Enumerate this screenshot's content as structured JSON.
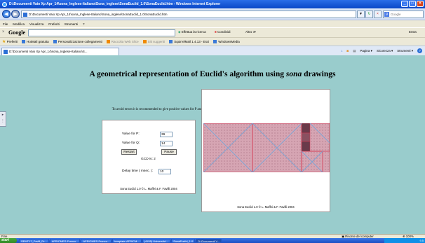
{
  "window": {
    "title": "D:\\Documenti Vaio Xp Apr_14\\sona_Inglese-Italiano\\Sona_inglese\\SonaEuclid_1.0\\SonaEuclid.htm - Windows Internet Explorer",
    "min": "_",
    "max": "□",
    "close": "×"
  },
  "address_bar": {
    "back": "◀",
    "forward": "▶",
    "url": "D:\\Documenti Vaio Xp Apr_14\\sona_Inglese-Italiano\\Sona_inglese\\SonaEuclid_1.0\\SonaEuclid.htm",
    "dropdown": "▼",
    "refresh": "↻",
    "stop": "×",
    "search_placeholder": "Google",
    "search_logo": "g",
    "search_go": "ρ"
  },
  "menu": [
    "File",
    "Modifica",
    "Visualizza",
    "Preferiti",
    "Strumenti",
    "?"
  ],
  "google_toolbar": {
    "close": "×",
    "logo": "Google",
    "search_go": "Effettua la ricerca",
    "share": "Condividi",
    "more": "Altro",
    "more_arrows": "≫",
    "signin": "Entra"
  },
  "links_bar": {
    "favorites": "Preferiti",
    "items": [
      {
        "label": "HotMail gratuita",
        "dim": false
      },
      {
        "label": "Personalizzazione collegamenti",
        "dim": false
      },
      {
        "label": "Raccolta Web Slice",
        "dim": true
      },
      {
        "label": "Siti suggeriti",
        "dim": true
      },
      {
        "label": "SquirrelMail 1.4.13 - Esci",
        "dim": false
      },
      {
        "label": "WindowsMedia",
        "dim": false
      }
    ]
  },
  "tab": {
    "label": "D:\\Documenti Vaio Xp Apr_14\\sona_Inglese-Italiano\\S..."
  },
  "command_bar": {
    "page": "Pagina",
    "security": "Sicurezza",
    "tools": "Strumenti",
    "help": "?"
  },
  "page": {
    "heading_prefix": "A geometrical representation of Euclid's algorithm using ",
    "heading_em": "sona",
    "heading_suffix": " drawings",
    "warning": "To avoid errors it is recommended to give positive values for P and Q.",
    "p_label": "Value for P:",
    "p_value": "36",
    "q_label": "Value for Q:",
    "q_value": "14",
    "restart": "Restart",
    "pause": "Pause",
    "gcd_label": "GCD is:",
    "gcd_value": "2",
    "delay_label": "Delay time ( msec. ):",
    "delay_value": "10",
    "credit_panel": "Sona Euclid 1.0 © L. Maffei & F. Favilli 2004",
    "credit_canvas": "Sona Euclid 1.0 © L. Maffei & F. Favilli 2004",
    "colors": {
      "background": "#99cccc",
      "grid_cell": "#d6a5b3",
      "red_line": "#d23c55",
      "blue_line": "#7aa3d4",
      "dark_square": "#6a3a4a"
    }
  },
  "status": {
    "left": "Fine",
    "zone": "Risorse del computer",
    "zoom": "100%"
  },
  "taskbar": {
    "start": "start",
    "items": [
      {
        "label": "SEMT17_FavB_Dr...",
        "active": false
      },
      {
        "label": "AFRICMES-Franco...",
        "active": false
      },
      {
        "label": "AFRICMES-Franco...",
        "active": false
      },
      {
        "label": "template-AFRICM...",
        "active": false
      },
      {
        "label": "(4155) Universita'...",
        "active": false
      },
      {
        "label": "SonaEuclid_1.0",
        "active": false
      },
      {
        "label": "D:\\Documenti V...",
        "active": true
      }
    ],
    "clock": "9.5"
  }
}
